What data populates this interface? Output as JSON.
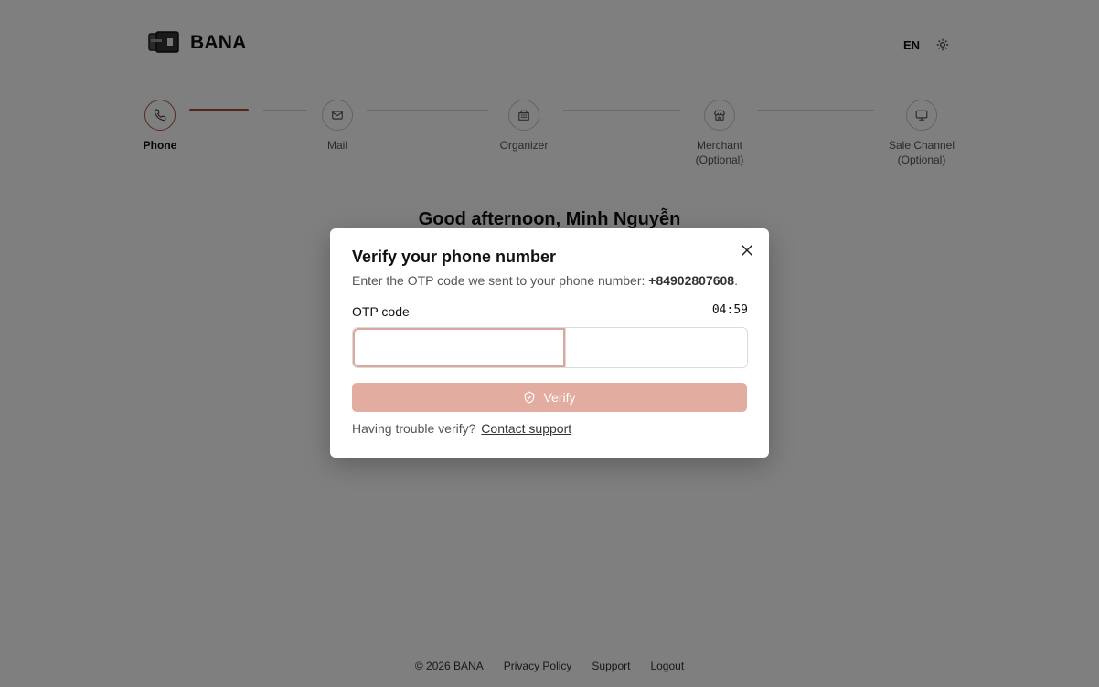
{
  "brand": {
    "name": "BANA"
  },
  "header": {
    "language": "EN",
    "theme_icon": "sun-icon"
  },
  "stepper": {
    "steps": [
      {
        "label": "Phone",
        "icon": "phone-icon",
        "active": true
      },
      {
        "label": "Mail",
        "icon": "mail-icon",
        "active": false
      },
      {
        "label": "Organizer",
        "icon": "building-icon",
        "active": false
      },
      {
        "label": "Merchant\n(Optional)",
        "icon": "store-icon",
        "active": false
      },
      {
        "label": "Sale Channel\n(Optional)",
        "icon": "monitor-icon",
        "active": false
      }
    ]
  },
  "greeting": "Good afternoon, Minh Nguyễn",
  "modal": {
    "title": "Verify your phone number",
    "description_prefix": "Enter the OTP code we sent to your phone number: ",
    "phone": "+84902807608",
    "description_suffix": ".",
    "otp_label": "OTP code",
    "timer": "04:59",
    "otp_digits": [
      "",
      "",
      "",
      "",
      "",
      ""
    ],
    "verify_label": "Verify",
    "trouble_text": "Having trouble verify?",
    "support_link": "Contact support"
  },
  "footer": {
    "copyright": "© 2026 BANA",
    "links": [
      "Privacy Policy",
      "Support",
      "Logout"
    ]
  },
  "colors": {
    "accent": "#a94a38",
    "button_disabled": "#e2aca1",
    "overlay": "#808080"
  }
}
